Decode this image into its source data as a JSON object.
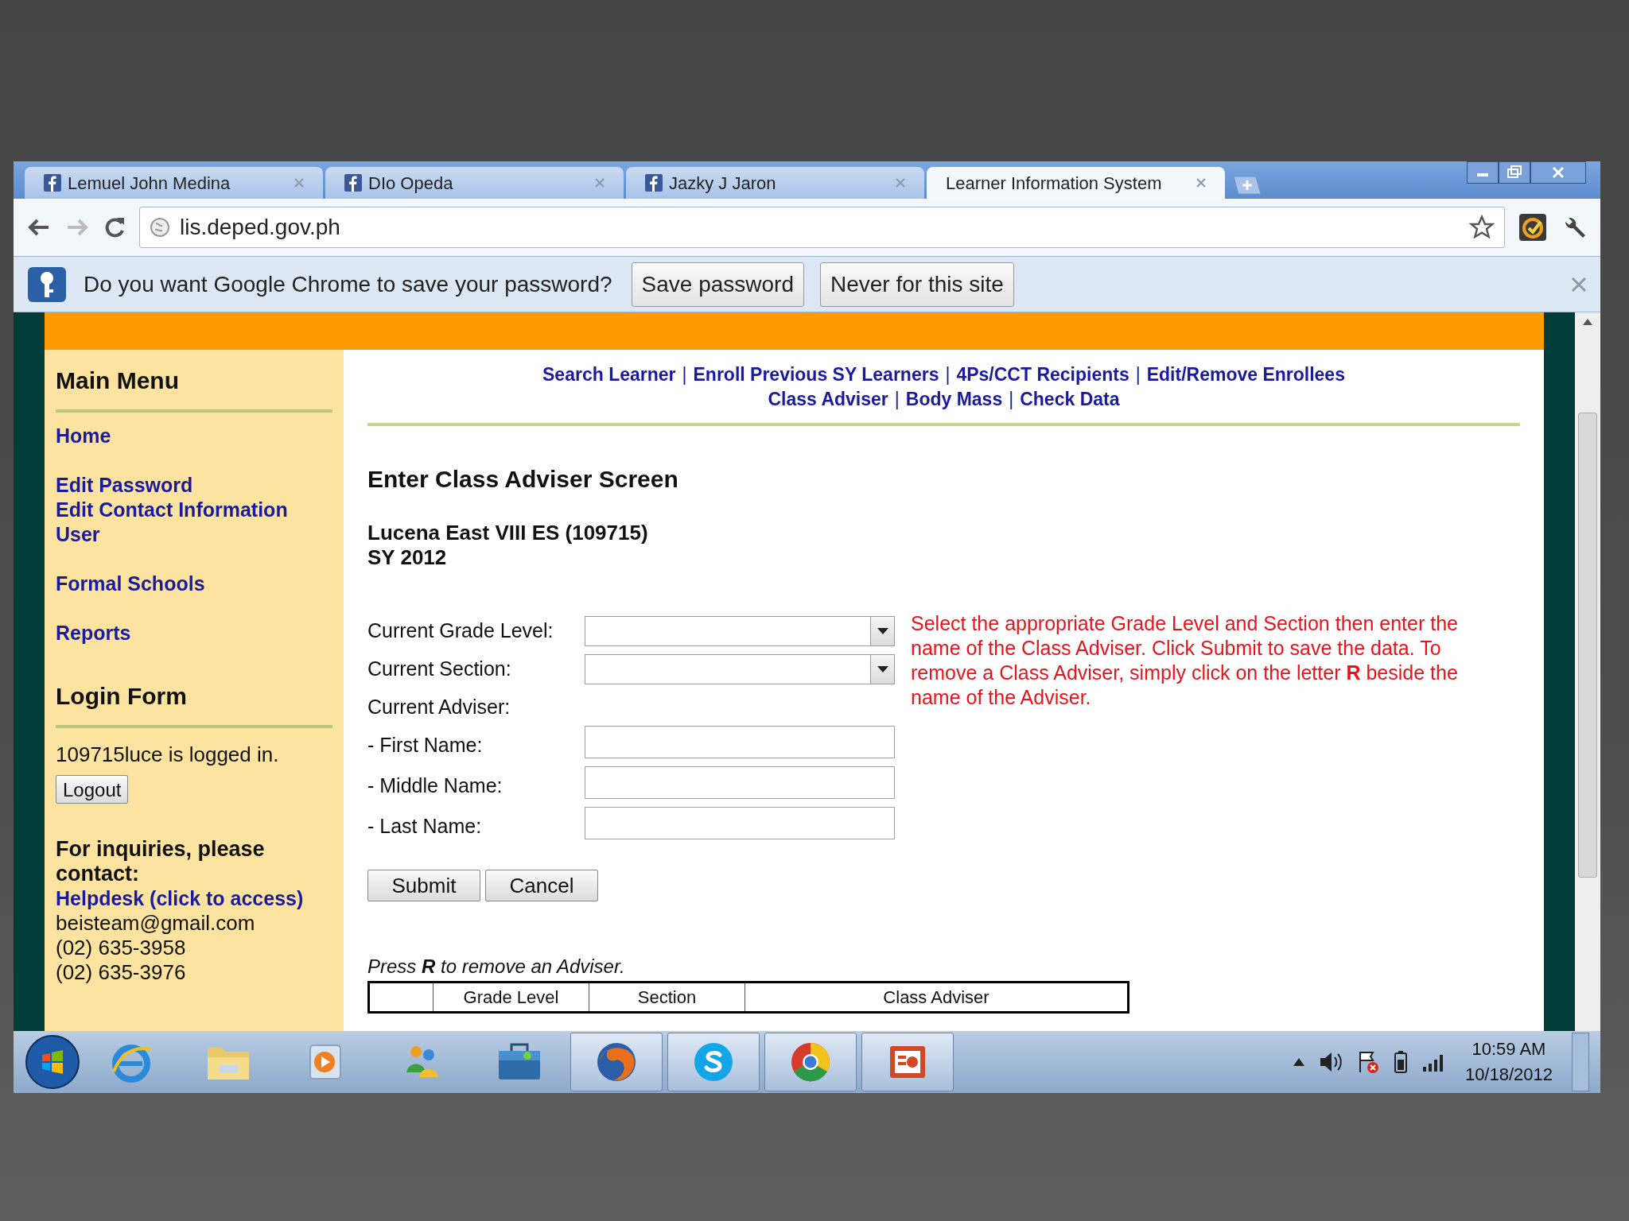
{
  "browser": {
    "tabs": [
      {
        "title": "Lemuel John Medina",
        "kind": "facebook",
        "selected": false
      },
      {
        "title": "DIo Opeda",
        "kind": "facebook",
        "selected": false
      },
      {
        "title": "Jazky J Jaron",
        "kind": "facebook",
        "selected": false
      },
      {
        "title": "Learner Information System",
        "kind": "plain",
        "selected": true
      }
    ],
    "address": "lis.deped.gov.ph",
    "infobar": {
      "message": "Do you want Google Chrome to save your password?",
      "buttons": [
        "Save password",
        "Never for this site"
      ]
    }
  },
  "sidebar": {
    "menu_title": "Main Menu",
    "menu_groups": [
      [
        "Home"
      ],
      [
        "Edit Password",
        "Edit Contact Information",
        "User"
      ],
      [
        "Formal Schools"
      ],
      [
        "Reports"
      ]
    ],
    "login_title": "Login Form",
    "login_status": "109715luce is logged in.",
    "logout": "Logout",
    "contact": {
      "heading": "For inquiries, please contact:",
      "helpdesk": "Helpdesk (click to access)",
      "lines": [
        "beisteam@gmail.com",
        "(02) 635-3958",
        "(02) 635-3976"
      ]
    }
  },
  "nav": {
    "lines": [
      {
        "items": [
          {
            "kind": "link",
            "text": "Search Learner"
          },
          {
            "kind": "separator",
            "text": "|"
          },
          {
            "kind": "link",
            "text": "Enroll Previous SY Learners"
          },
          {
            "kind": "separator",
            "text": "|"
          },
          {
            "kind": "link",
            "text": "4Ps/CCT Recipients"
          },
          {
            "kind": "separator",
            "text": "|"
          },
          {
            "kind": "link",
            "text": "Edit/Remove Enrollees"
          }
        ]
      },
      {
        "items": [
          {
            "kind": "link",
            "text": "Class Adviser"
          },
          {
            "kind": "separator",
            "text": "|"
          },
          {
            "kind": "link",
            "text": "Body Mass"
          },
          {
            "kind": "separator",
            "text": "|"
          },
          {
            "kind": "link",
            "text": "Check Data"
          }
        ]
      }
    ]
  },
  "main": {
    "title": "Enter Class Adviser Screen",
    "school": "Lucena East VIII ES (109715)",
    "sy": "SY 2012",
    "fields": [
      {
        "kind": "select",
        "label": "Current Grade Level:"
      },
      {
        "kind": "select",
        "label": "Current Section:"
      },
      {
        "kind": "heading",
        "label": "Current Adviser:"
      },
      {
        "kind": "input",
        "label": "- First Name:"
      },
      {
        "kind": "input",
        "label": "- Middle Name:"
      },
      {
        "kind": "input",
        "label": "- Last Name:"
      }
    ],
    "help": "Select the appropriate Grade Level and Section then enter the name of the Class Adviser. Click Submit to save the data. To remove a Class Adviser, simply click on the letter **R** beside the name of the Adviser.",
    "buttons": [
      "Submit",
      "Cancel"
    ],
    "table_note": "Press **R** to remove an Adviser.",
    "table": {
      "columns": [
        "Grade Level",
        "Section",
        "Class Adviser"
      ]
    }
  },
  "taskbar": {
    "apps": [
      {
        "kind": "ie",
        "running": false
      },
      {
        "kind": "folder",
        "running": false
      },
      {
        "kind": "media",
        "running": false
      },
      {
        "kind": "people",
        "running": false
      },
      {
        "kind": "briefcase",
        "running": false
      },
      {
        "kind": "firefox",
        "running": true
      },
      {
        "kind": "skype",
        "running": true
      },
      {
        "kind": "chrome",
        "running": true
      },
      {
        "kind": "slides",
        "running": true
      }
    ],
    "time": "10:59 AM",
    "date": "10/18/2012"
  }
}
